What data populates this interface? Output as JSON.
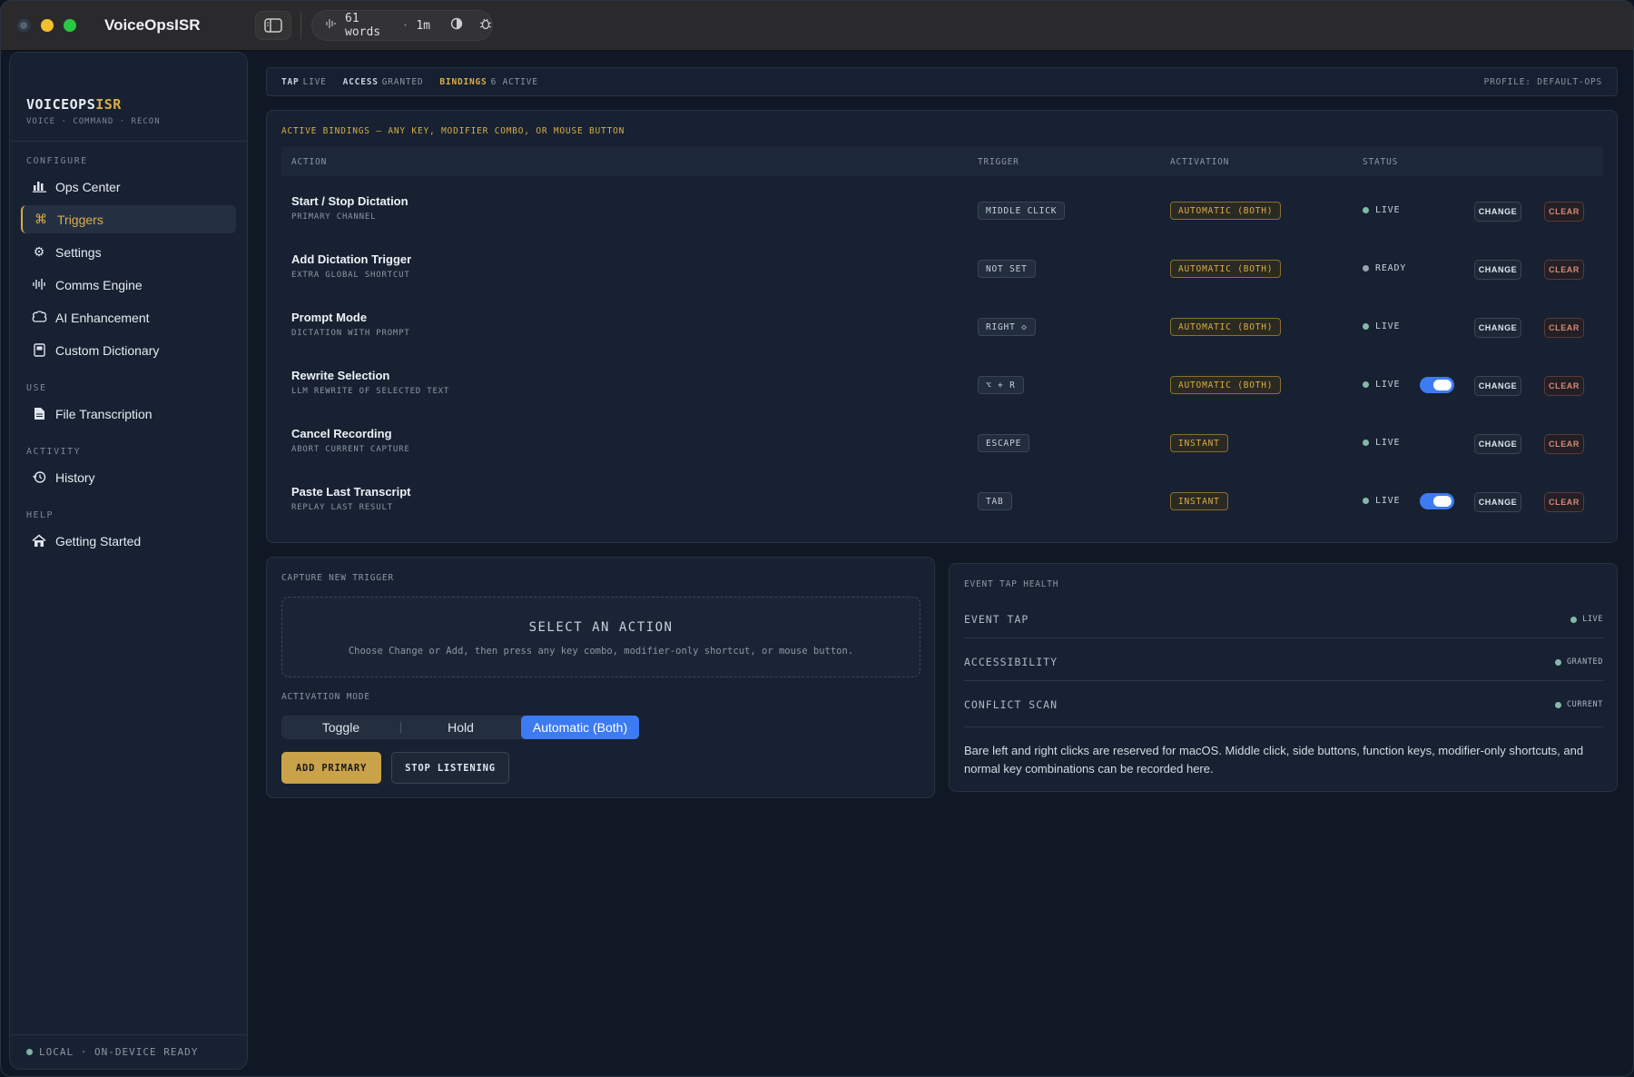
{
  "window": {
    "title": "VoiceOpsISR",
    "toolbar": {
      "word_count": "61 words",
      "separator": "·",
      "duration": "1m"
    }
  },
  "sidebar": {
    "brand_main": "VOICEOPS",
    "brand_accent": "ISR",
    "brand_sub": "VOICE · COMMAND · RECON",
    "sections": {
      "configure": "CONFIGURE",
      "use": "USE",
      "activity": "ACTIVITY",
      "help": "HELP"
    },
    "items": {
      "ops_center": "Ops Center",
      "triggers": "Triggers",
      "settings": "Settings",
      "comms_engine": "Comms Engine",
      "ai_enhancement": "AI Enhancement",
      "custom_dictionary": "Custom Dictionary",
      "file_transcription": "File Transcription",
      "history": "History",
      "getting_started": "Getting Started"
    },
    "footer": "LOCAL · ON-DEVICE READY"
  },
  "strip": {
    "tap_label": "TAP",
    "tap_value": "LIVE",
    "access_label": "ACCESS",
    "access_value": "GRANTED",
    "bindings_label": "BINDINGS",
    "bindings_value": "6 ACTIVE",
    "profile": "PROFILE: DEFAULT-OPS"
  },
  "bindings": {
    "title": "ACTIVE BINDINGS — ANY KEY, MODIFIER COMBO, OR MOUSE BUTTON",
    "columns": {
      "action": "ACTION",
      "trigger": "TRIGGER",
      "activation": "ACTIVATION",
      "status": "STATUS"
    },
    "change_label": "CHANGE",
    "clear_label": "CLEAR",
    "rows": [
      {
        "name": "Start / Stop Dictation",
        "sub": "PRIMARY CHANNEL",
        "trigger": "MIDDLE CLICK",
        "activation": "AUTOMATIC (BOTH)",
        "status": "LIVE",
        "toggle": false
      },
      {
        "name": "Add Dictation Trigger",
        "sub": "EXTRA GLOBAL SHORTCUT",
        "trigger": "NOT SET",
        "activation": "AUTOMATIC (BOTH)",
        "status": "READY",
        "toggle": false
      },
      {
        "name": "Prompt Mode",
        "sub": "DICTATION WITH PROMPT",
        "trigger": "RIGHT ◇",
        "activation": "AUTOMATIC (BOTH)",
        "status": "LIVE",
        "toggle": false
      },
      {
        "name": "Rewrite Selection",
        "sub": "LLM REWRITE OF SELECTED TEXT",
        "trigger": "⌥ + R",
        "activation": "AUTOMATIC (BOTH)",
        "status": "LIVE",
        "toggle": true
      },
      {
        "name": "Cancel Recording",
        "sub": "ABORT CURRENT CAPTURE",
        "trigger": "ESCAPE",
        "activation": "INSTANT",
        "status": "LIVE",
        "toggle": false
      },
      {
        "name": "Paste Last Transcript",
        "sub": "REPLAY LAST RESULT",
        "trigger": "TAB",
        "activation": "INSTANT",
        "status": "LIVE",
        "toggle": true
      }
    ]
  },
  "capture": {
    "title": "CAPTURE NEW TRIGGER",
    "drop_title": "SELECT AN ACTION",
    "drop_sub": "Choose Change or Add, then press any key combo, modifier-only shortcut, or mouse button.",
    "mode_label": "ACTIVATION MODE",
    "modes": [
      "Toggle",
      "Hold",
      "Automatic (Both)"
    ],
    "selected_mode": "Automatic (Both)",
    "add_button": "ADD PRIMARY",
    "stop_button": "STOP LISTENING"
  },
  "health": {
    "title": "EVENT TAP HEALTH",
    "rows": [
      {
        "label": "EVENT TAP",
        "value": "LIVE"
      },
      {
        "label": "ACCESSIBILITY",
        "value": "GRANTED"
      },
      {
        "label": "CONFLICT SCAN",
        "value": "CURRENT"
      }
    ],
    "note": "Bare left and right clicks are reserved for macOS. Middle click, side buttons, function keys, modifier-only shortcuts, and normal key combinations can be recorded here."
  },
  "colors": {
    "accent_gold": "#d9ad48",
    "accent_blue": "#3d7bf2",
    "live_green": "#86b8aa",
    "clear_red": "#d48a7a"
  }
}
